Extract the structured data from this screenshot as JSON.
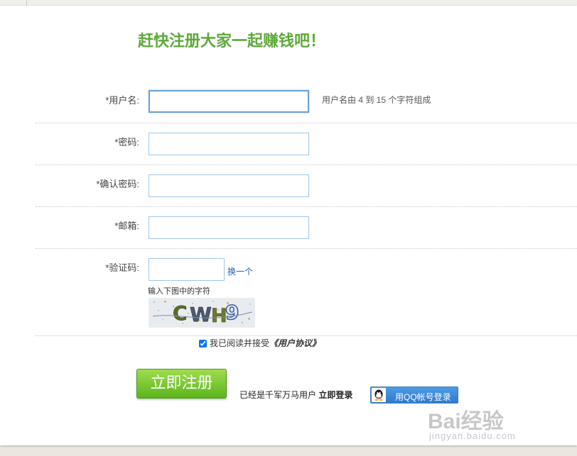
{
  "header": {
    "title": "赶快注册大家一起赚钱吧！"
  },
  "form": {
    "username": {
      "label": "*用户名:",
      "hint": "用户名由 4 到 15 个字符组成",
      "value": ""
    },
    "password": {
      "label": "*密码:",
      "value": ""
    },
    "confirm_password": {
      "label": "*确认密码:",
      "value": ""
    },
    "email": {
      "label": "*邮箱:",
      "value": ""
    },
    "captcha": {
      "label": "*验证码:",
      "value": "",
      "change_link": "换一个",
      "hint": "输入下图中的字符",
      "image_text": "CWH9"
    },
    "agreement": {
      "prefix": "我已阅读并接受",
      "link": "《用户协议》",
      "checked": true
    }
  },
  "actions": {
    "register_button": "立即注册",
    "already_user": "已经是千军万马用户",
    "login_link": "立即登录",
    "qq_login": "用QQ帐号登录"
  },
  "watermark": {
    "main": "Bai经验",
    "sub": "jingyan.baidu.com"
  },
  "colors": {
    "title": "#5ea83b",
    "register_button": "#6cbf25",
    "qq_button": "#3b88d6",
    "input_border": "#9ec6e9"
  }
}
